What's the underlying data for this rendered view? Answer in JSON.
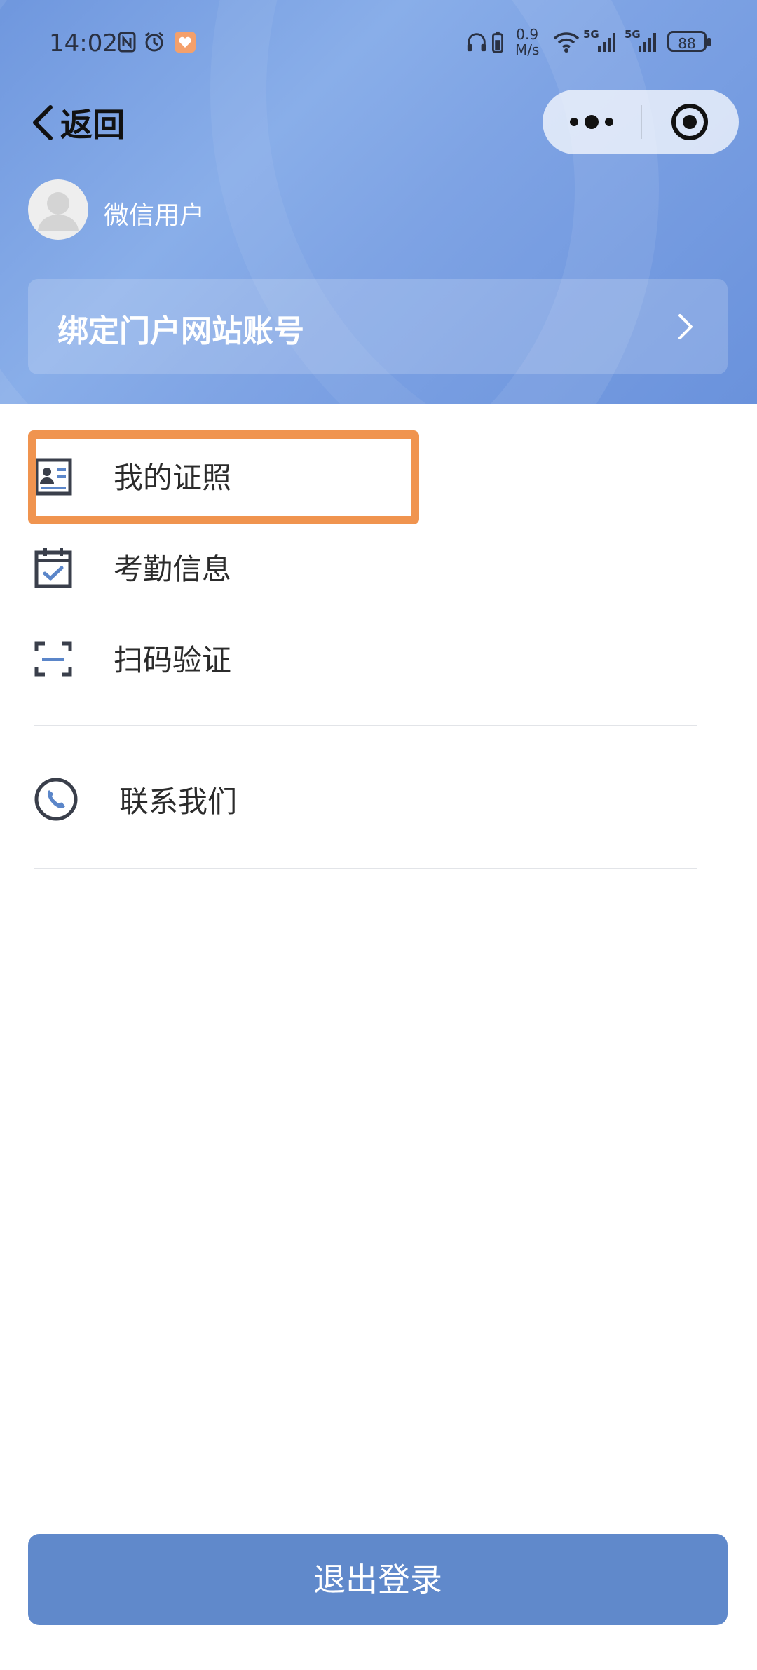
{
  "status_bar": {
    "time": "14:02",
    "speed_value": "0.9",
    "speed_unit": "M/s",
    "network_1": "5G",
    "network_2": "5G",
    "battery": "88"
  },
  "nav": {
    "back_label": "返回"
  },
  "user": {
    "name": "微信用户"
  },
  "bind_account": {
    "label": "绑定门户网站账号"
  },
  "menu": {
    "items": [
      {
        "label": "我的证照",
        "icon": "id-card-icon"
      },
      {
        "label": "考勤信息",
        "icon": "calendar-check-icon"
      },
      {
        "label": "扫码验证",
        "icon": "scan-icon"
      },
      {
        "label": "联系我们",
        "icon": "phone-icon"
      }
    ]
  },
  "logout": {
    "label": "退出登录"
  },
  "colors": {
    "header_blue": "#7ea3e4",
    "logout_button": "#6089cb",
    "highlight_orange": "#f0944f"
  }
}
